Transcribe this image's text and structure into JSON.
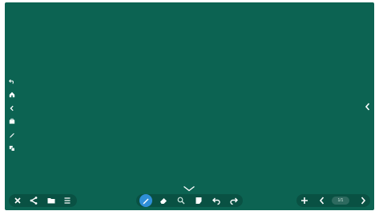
{
  "board": {
    "background_color": "#0c6352",
    "icon_color": "#ffffff",
    "accent_color": "#2f8fd8"
  },
  "left_toolbar": [
    {
      "icon": "undo-icon"
    },
    {
      "icon": "home-icon"
    },
    {
      "icon": "chevron-left-icon"
    },
    {
      "icon": "toolbox-icon"
    },
    {
      "icon": "pen-icon"
    },
    {
      "icon": "layers-icon"
    }
  ],
  "right_edge": {
    "icon": "chevron-left-icon"
  },
  "bottom_center_handle": {
    "icon": "chevron-down-icon"
  },
  "bottom_left_toolbar": [
    "close-icon",
    "share-icon",
    "folder-icon",
    "menu-icon"
  ],
  "bottom_center_toolbar": {
    "tools": [
      "pen-icon",
      "eraser-icon",
      "select-icon",
      "note-icon",
      "undo-icon",
      "redo-icon"
    ],
    "active_tool": "pen-icon"
  },
  "bottom_right_toolbar": {
    "add": "plus-icon",
    "prev": "chevron-left-icon",
    "page_indicator": "1/1",
    "next": "chevron-right-icon"
  }
}
